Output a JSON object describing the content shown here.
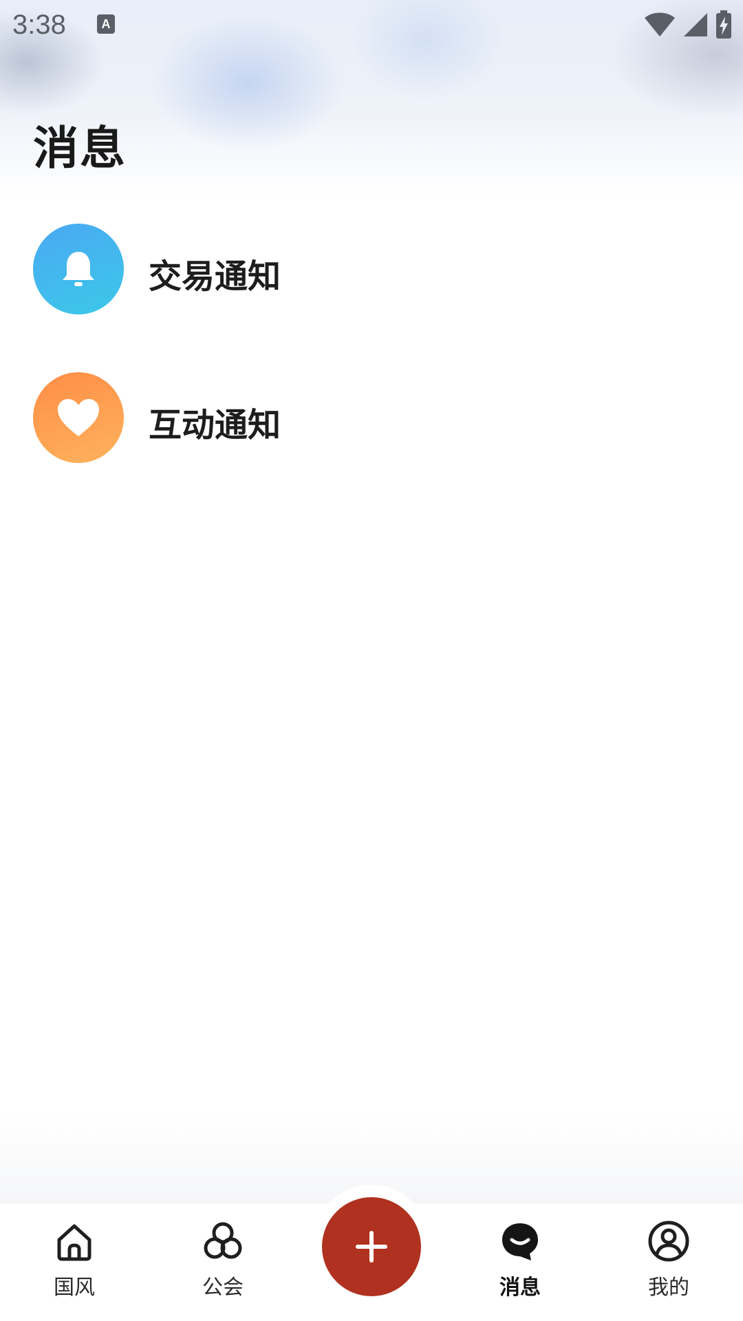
{
  "status_bar": {
    "time": "3:38",
    "left_icons": [
      "keyboard-a-icon"
    ],
    "right_icons": [
      "wifi-icon",
      "cellular-signal-icon",
      "battery-charging-icon"
    ]
  },
  "header": {
    "title": "消息"
  },
  "notifications": [
    {
      "label": "交易通知",
      "icon": "bell-icon",
      "color": "#4aa9f3"
    },
    {
      "label": "互动通知",
      "icon": "heart-icon",
      "color": "#fe9a4d"
    }
  ],
  "tab_bar": {
    "items": [
      {
        "label": "国风",
        "icon": "home-icon",
        "active": false
      },
      {
        "label": "公会",
        "icon": "guild-icon",
        "active": false
      },
      {
        "label": "",
        "icon": "plus-icon",
        "active": false
      },
      {
        "label": "消息",
        "icon": "message-icon",
        "active": true
      },
      {
        "label": "我的",
        "icon": "profile-icon",
        "active": false
      }
    ],
    "fab_color": "#b0311f"
  }
}
